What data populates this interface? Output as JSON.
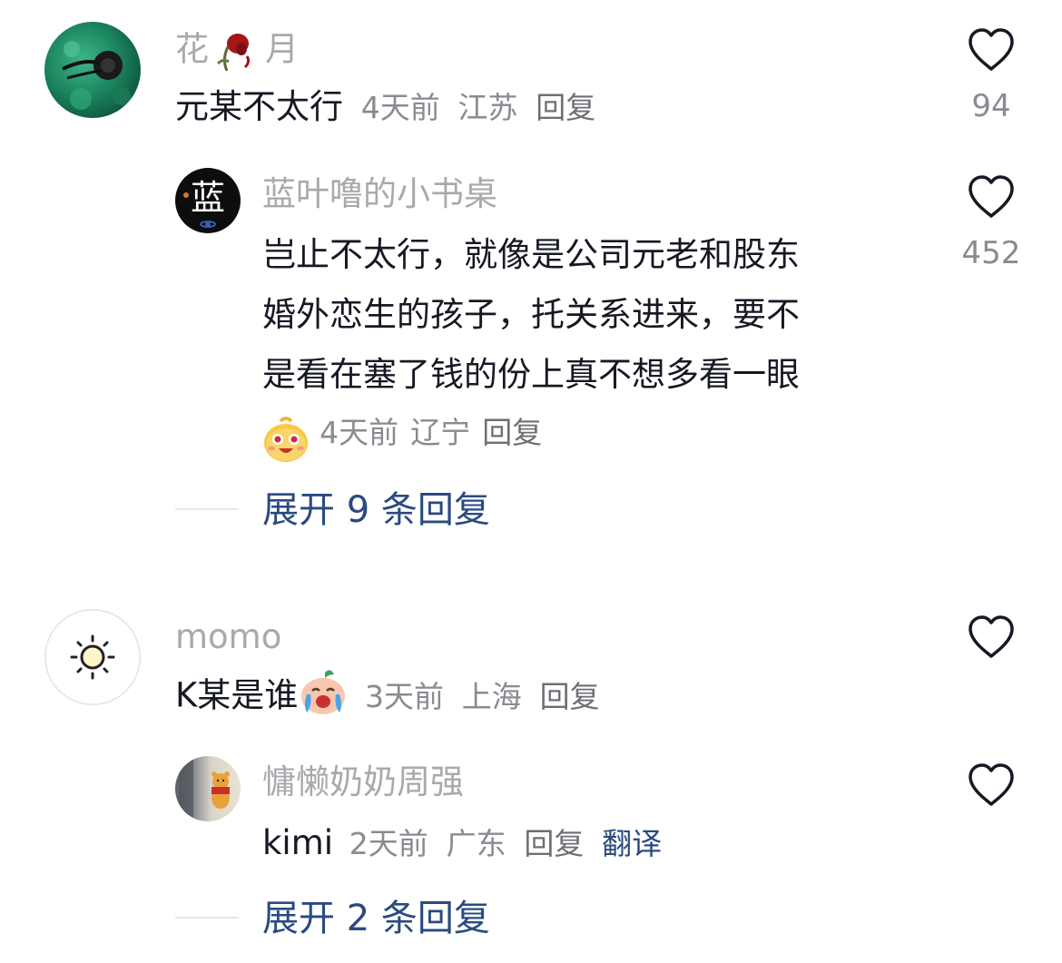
{
  "comments": [
    {
      "user": "花",
      "user_suffix": "月",
      "text": "元某不太行",
      "time": "4天前",
      "location": "江苏",
      "reply_label": "回复",
      "likes": "94",
      "replies": [
        {
          "user": "蓝叶噜的小书桌",
          "avatar_text": "蓝",
          "text_lines": [
            "岂止不太行，就像是公司元老和股东",
            "婚外恋生的孩子，托关系进来，要不",
            "是看在塞了钱的份上真不想多看一眼"
          ],
          "time": "4天前",
          "location": "辽宁",
          "reply_label": "回复",
          "likes": "452"
        }
      ],
      "expand_label": "展开 9 条回复"
    },
    {
      "user": "momo",
      "text": "K某是谁",
      "time": "3天前",
      "location": "上海",
      "reply_label": "回复",
      "replies": [
        {
          "user": "慵懒奶奶周强",
          "text": "kimi",
          "time": "2天前",
          "location": "广东",
          "reply_label": "回复",
          "translate_label": "翻译"
        }
      ],
      "expand_label": "展开 2 条回复"
    }
  ],
  "colors": {
    "name_gray": "#a8a9ad",
    "meta_gray": "#8a8b91",
    "link_blue": "#2a4a80"
  }
}
